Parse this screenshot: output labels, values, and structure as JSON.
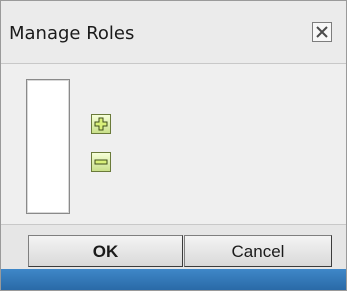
{
  "dialog": {
    "title": "Manage Roles",
    "close_icon": "close-icon"
  },
  "roles": {
    "items": []
  },
  "actions": {
    "add_icon": "plus-icon",
    "remove_icon": "minus-icon"
  },
  "footer": {
    "ok_label": "OK",
    "cancel_label": "Cancel"
  },
  "colors": {
    "icon_fill": "#c9e08a",
    "bottom_bar": "#2a6aa7"
  }
}
